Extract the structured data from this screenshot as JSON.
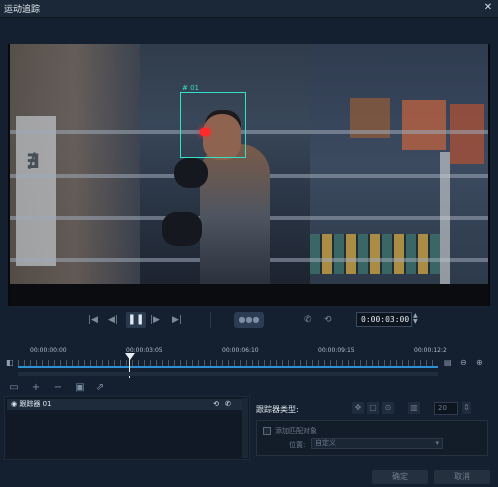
{
  "window": {
    "title": "运动追踪",
    "close_icon": "close-icon"
  },
  "preview": {
    "tracker_label": "01",
    "timecode": "0:00:03:00"
  },
  "controls": {
    "icons": [
      "go-to-start-icon",
      "previous-frame-icon",
      "pause-icon",
      "next-frame-icon",
      "go-to-end-icon",
      "tracking-mode-icon",
      "phone-icon",
      "history-icon"
    ]
  },
  "timeline": {
    "ticks": [
      "00:00:00:00",
      "00:00:03:05",
      "00:00:06:10",
      "00:00:09:15",
      "00:00:12:2"
    ],
    "playhead_fraction": 0.26
  },
  "tracker_list": {
    "items": [
      {
        "label": "跟踪器 01"
      }
    ]
  },
  "properties": {
    "tracker_type_label": "跟踪器类型:",
    "size_value": "20",
    "add_object_label": "添加匹配对象",
    "position_label": "位置:",
    "position_value": "自定义"
  },
  "buttons": {
    "ok": "确定",
    "cancel": "取消"
  }
}
